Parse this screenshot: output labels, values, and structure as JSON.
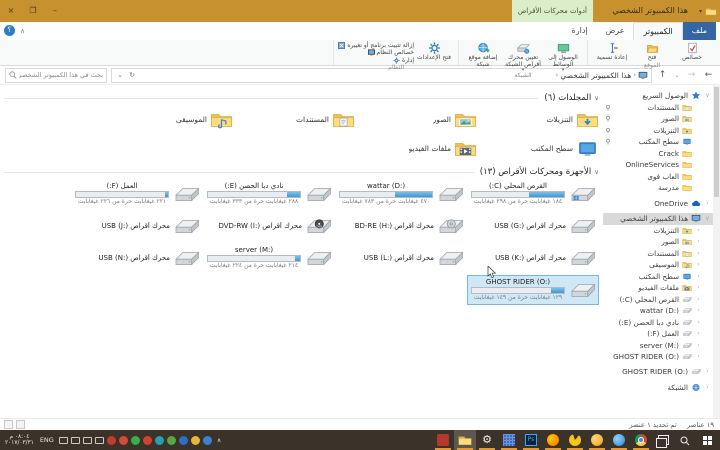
{
  "window": {
    "title": "هذا الكمبيوتر الشخصي",
    "contextual_tab_label": "أدوات محركات الأقراص",
    "controls": {
      "close": "×",
      "restore": "❐",
      "minimize": "–"
    }
  },
  "ribbon": {
    "help_label": "؟",
    "tabs": [
      {
        "id": "file",
        "label": "ملف"
      },
      {
        "id": "computer",
        "label": "الكمبيوتر",
        "active": true
      },
      {
        "id": "view",
        "label": "عرض"
      },
      {
        "id": "manage",
        "label": "إدارة",
        "contextual": true
      }
    ],
    "groups": [
      {
        "label": "الموقع",
        "buttons": [
          {
            "label": "خصائص",
            "icon": "properties"
          },
          {
            "label": "فتح",
            "icon": "open-folder"
          },
          {
            "label": "إعادة تسمية",
            "icon": "rename"
          }
        ]
      },
      {
        "label": "الشبكة",
        "buttons": [
          {
            "label": "الوصول إلى الوسائط",
            "icon": "access-media",
            "dropdown": true
          },
          {
            "label": "تعيين محرك أقراص الشبكة",
            "icon": "map-network-drive",
            "dropdown": true
          },
          {
            "label": "إضافة موقع شبكة",
            "icon": "add-network-location"
          }
        ]
      },
      {
        "label": "النظام",
        "buttons": [
          {
            "label": "فتح الإعدادات",
            "icon": "settings"
          }
        ],
        "small_buttons": [
          {
            "label": "إزالة تثبيت برنامج أو تغييره",
            "icon": "uninstall"
          },
          {
            "label": "خصائص النظام",
            "icon": "system-properties"
          },
          {
            "label": "إدارة",
            "icon": "manage"
          }
        ]
      }
    ]
  },
  "navigation": {
    "back": "←",
    "forward": "→",
    "recent": "⌄",
    "up": "↑",
    "breadcrumb_root": "هذا الكمبيوتر الشخصي",
    "refresh": "↻",
    "search_placeholder": "بحث في هذا الكمبيوتر الشخصي"
  },
  "sidebar": {
    "items": [
      {
        "label": "الوصول السريع",
        "icon": "quick-access",
        "indent": 0,
        "chevron": "expanded"
      },
      {
        "label": "المستندات",
        "icon": "folder-documents",
        "indent": 1,
        "pinned": true
      },
      {
        "label": "الصور",
        "icon": "folder-pictures",
        "indent": 1,
        "pinned": true
      },
      {
        "label": "التنزيلات",
        "icon": "folder-downloads",
        "indent": 1,
        "pinned": true
      },
      {
        "label": "سطح المكتب",
        "icon": "folder-desktop",
        "indent": 1,
        "pinned": true
      },
      {
        "label": "Crack",
        "icon": "folder",
        "indent": 1
      },
      {
        "label": "OnlineServices",
        "icon": "folder",
        "indent": 1
      },
      {
        "label": "العاب قوى",
        "icon": "folder",
        "indent": 1
      },
      {
        "label": "مدرسة",
        "icon": "folder",
        "indent": 1
      },
      {
        "label": "OneDrive",
        "icon": "onedrive",
        "indent": 0,
        "chevron": "collapsed",
        "gap": 4
      },
      {
        "label": "هذا الكمبيوتر الشخصي",
        "icon": "this-pc",
        "indent": 0,
        "chevron": "expanded",
        "selected": true,
        "gap": 4
      },
      {
        "label": "التنزيلات",
        "icon": "folder-downloads",
        "indent": 1,
        "chevron": "collapsed"
      },
      {
        "label": "الصور",
        "icon": "folder-pictures",
        "indent": 1,
        "chevron": "collapsed"
      },
      {
        "label": "المستندات",
        "icon": "folder-documents",
        "indent": 1,
        "chevron": "collapsed"
      },
      {
        "label": "الموسيقى",
        "icon": "folder-music",
        "indent": 1,
        "chevron": "collapsed"
      },
      {
        "label": "سطح المكتب",
        "icon": "folder-desktop",
        "indent": 1,
        "chevron": "collapsed"
      },
      {
        "label": "ملفات الفيديو",
        "icon": "folder-videos",
        "indent": 1,
        "chevron": "collapsed"
      },
      {
        "label": "القرص المحلي (C:)",
        "icon": "drive",
        "indent": 1,
        "chevron": "collapsed"
      },
      {
        "label": "wattar (D:)",
        "icon": "drive",
        "indent": 1,
        "chevron": "collapsed"
      },
      {
        "label": "نادي دبا الحصن (E:)",
        "icon": "drive",
        "indent": 1,
        "chevron": "collapsed"
      },
      {
        "label": "العمل (F:)",
        "icon": "drive",
        "indent": 1,
        "chevron": "collapsed"
      },
      {
        "label": "server (M:)",
        "icon": "drive",
        "indent": 1,
        "chevron": "collapsed"
      },
      {
        "label": "GHOST RIDER (O:)",
        "icon": "drive",
        "indent": 1,
        "chevron": "collapsed"
      },
      {
        "label": "GHOST RIDER (O:)",
        "icon": "drive",
        "indent": 0,
        "chevron": "collapsed",
        "gap": 3
      },
      {
        "label": "الشبكة",
        "icon": "network",
        "indent": 0,
        "chevron": "collapsed",
        "gap": 5
      }
    ]
  },
  "content": {
    "folders": {
      "title": "المجلدات (٦)",
      "items": [
        {
          "label": "التنزيلات",
          "icon": "folder-downloads"
        },
        {
          "label": "الصور",
          "icon": "folder-pictures"
        },
        {
          "label": "المستندات",
          "icon": "folder-documents"
        },
        {
          "label": "الموسيقى",
          "icon": "folder-music"
        },
        {
          "label": "سطح المكتب",
          "icon": "folder-desktop"
        },
        {
          "label": "ملفات الفيديو",
          "icon": "folder-videos"
        }
      ]
    },
    "drives": {
      "title": "الأجهزة ومحركات الأقراص (١٣)",
      "items": [
        {
          "label": "القرص المحلي (C:)",
          "icon": "drive-windows",
          "free_text": "١٨٤ غيغابايت حرة من ٢٩٨ غيغابايت",
          "used_pct": 38
        },
        {
          "label": "wattar (D:)",
          "icon": "drive",
          "free_text": "٤٧٠ غيغابايت حرة من ٧٨٣ غيغابايت",
          "used_pct": 40
        },
        {
          "label": "نادي دبا الحصن (E:)",
          "icon": "drive",
          "free_text": "٢٨٨ غيغابايت حرة من ٣٣٣ غيغابايت",
          "used_pct": 14
        },
        {
          "label": "العمل (F:)",
          "icon": "drive",
          "free_text": "٢٢١ غيغابايت حرة من ٢٢٦ غيغابايت",
          "used_pct": 3
        },
        {
          "label": "محرك أقراص USB (G:)",
          "icon": "drive"
        },
        {
          "label": "محرك أقراص BD-RE (H:)",
          "icon": "drive-bd"
        },
        {
          "label": "محرك أقراص DVD-RW (I:)",
          "icon": "drive-dvd"
        },
        {
          "label": "محرك أقراص USB (J:)",
          "icon": "drive"
        },
        {
          "label": "محرك أقراص USB (K:)",
          "icon": "drive"
        },
        {
          "label": "محرك أقراص USB (L:)",
          "icon": "drive"
        },
        {
          "label": "server (M:)",
          "icon": "drive",
          "free_text": "٢١٤ غيغابايت حرة من ٢٢٤ غيغابايت",
          "used_pct": 5
        },
        {
          "label": "محرك أقراص USB (N:)",
          "icon": "drive"
        },
        {
          "label": "GHOST RIDER (O:)",
          "icon": "drive",
          "free_text": "١٢٩ غيغابايت حرة من ١٤٩ غيغابايت",
          "used_pct": 14,
          "selected": true
        }
      ]
    }
  },
  "statusbar": {
    "items_count": "١٩ عناصر",
    "selection": "تم تحديد ١ عنصر"
  },
  "taskbar": {
    "clock_time": "٠٨:٠٤ م",
    "clock_date": "٢٠١٧/٠٣/٣١",
    "language": "ENG",
    "tray": [
      "touch-keyboard",
      "volume",
      "display",
      "usb-device",
      "media-player-red",
      "antivirus-shield",
      "messenger-green",
      "app-red",
      "app-teal",
      "app-green",
      "app-blue",
      "app-yellow",
      "app-globe",
      "hidden-icons-chevron"
    ],
    "apps": [
      {
        "name": "media-app-red",
        "underline": true
      },
      {
        "name": "file-explorer",
        "active": true,
        "underline": true
      },
      {
        "name": "settings",
        "underline": true
      },
      {
        "name": "retro-app",
        "underline": true
      },
      {
        "name": "photoshop",
        "label": "Ps",
        "underline": true
      },
      {
        "name": "firefox",
        "underline": true
      },
      {
        "name": "media-yellow",
        "underline": true
      },
      {
        "name": "media-orange",
        "underline": true
      },
      {
        "name": "app-blue-sphere",
        "underline": true
      },
      {
        "name": "chrome",
        "underline": true
      },
      {
        "name": "task-view"
      },
      {
        "name": "search"
      },
      {
        "name": "start"
      }
    ]
  }
}
